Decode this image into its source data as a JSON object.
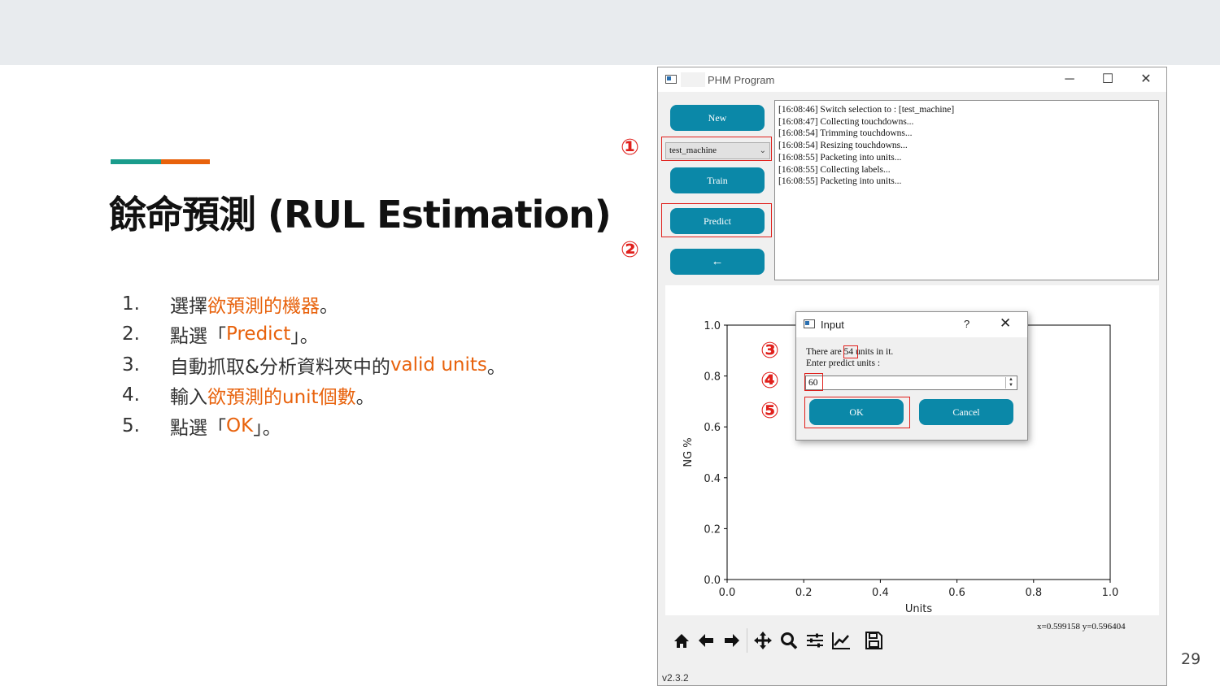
{
  "colors": {
    "teal": "#1a9c8c",
    "orange": "#e8620c",
    "button": "#0b88a8",
    "annotation_red": "#e0201c"
  },
  "slide": {
    "title": "餘命預測 (RUL Estimation)",
    "page_number": "29",
    "steps": [
      {
        "num": "1.",
        "pre": "選擇",
        "hl": "欲預測的機器",
        "post": "。"
      },
      {
        "num": "2.",
        "pre": "點選「",
        "hl": "Predict",
        "post": "」。"
      },
      {
        "num": "3.",
        "pre": "自動抓取&分析資料夾中的",
        "hl": "valid units",
        "post": "。"
      },
      {
        "num": "4.",
        "pre": "輸入",
        "hl": "欲預測的unit個數",
        "post": "。"
      },
      {
        "num": "5.",
        "pre": "點選「",
        "hl": "OK",
        "post": "」。"
      }
    ]
  },
  "annotations": [
    "①",
    "②",
    "③",
    "④",
    "⑤"
  ],
  "window": {
    "title": "PHM Program",
    "controls": {
      "minimize": "─",
      "maximize": "☐",
      "close": "✕"
    },
    "buttons": {
      "new": "New",
      "train": "Train",
      "predict": "Predict",
      "back": "←"
    },
    "machine_select": "test_machine",
    "log": [
      "[16:08:46] Switch selection to : [test_machine]",
      "[16:08:47] Collecting touchdowns...",
      "[16:08:54] Trimming touchdowns...",
      "[16:08:54] Resizing touchdowns...",
      "[16:08:55] Packeting into units...",
      "[16:08:55] Collecting labels...",
      "[16:08:55] Packeting into units..."
    ],
    "coords_readout": "x=0.599158    y=0.596404",
    "version": "v2.3.2",
    "toolbar_icons": [
      "home-icon",
      "back-arrow-icon",
      "forward-arrow-icon",
      "pan-icon",
      "zoom-icon",
      "configure-subplots-icon",
      "edit-axis-icon",
      "save-icon"
    ]
  },
  "chart_data": {
    "type": "line",
    "xlabel": "Units",
    "ylabel": "NG %",
    "xlim": [
      0,
      1
    ],
    "ylim": [
      0,
      1
    ],
    "x_ticks": [
      "0.0",
      "0.2",
      "0.4",
      "0.6",
      "0.8",
      "1.0"
    ],
    "y_ticks": [
      "0.0",
      "0.2",
      "0.4",
      "0.6",
      "0.8",
      "1.0"
    ],
    "series": []
  },
  "dialog": {
    "title": "Input",
    "help": "?",
    "close": "✕",
    "text_pre": "There are ",
    "count": "54",
    "text_post": " units in it.",
    "prompt": "Enter predict units :",
    "value": "60",
    "ok": "OK",
    "cancel": "Cancel"
  }
}
